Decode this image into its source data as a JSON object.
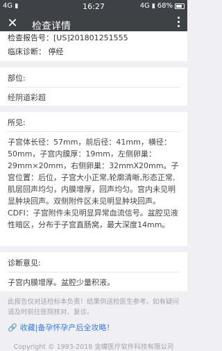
{
  "status_bar": {
    "network": "4G",
    "signal_icon": "signal-icon",
    "time": "16:27",
    "right_network": "4G",
    "battery": "68%"
  },
  "header": {
    "close_icon": "close-icon",
    "title": "检查详情",
    "more_icon": "more-vertical-icon"
  },
  "info": {
    "report_no": "检查报告号：[US]201801251555",
    "clinical_diagnosis": "临床诊断：   停经"
  },
  "position": {
    "title": "部位:",
    "text": "经阴道彩超"
  },
  "findings": {
    "title": "所见:",
    "text": "子宫体长径：57mm，前后径：41mm，横径：50mm，子宫内膜厚：19mm，左侧卵巢：29mm×20mm，右侧卵巢：32mmX20mm。子宫位置：后位，子宫大小正常,轮廓清晰,形态正常,肌层回声均匀，内膜增厚，回声均匀。宫内未见明显肿块回声。双侧附件区未见明显肿块回声。CDFI：子宫附件未见明显异常血流信号。盆腔见液性暗区，分布于子宫直肠窝，最大深度14mm。"
  },
  "diagnosis": {
    "title": "诊断意见:",
    "text": "子宫内膜增厚。盆腔少量积液。"
  },
  "disclaimer": "此报告仅对送检标本负责！结果供送检医生参考。如有疑问请及时前往医院核对、复诊。",
  "promo": {
    "icon": "link-icon",
    "text": "收藏|备孕怀孕产后全攻略！"
  },
  "copyright": "Copyright © 1993-2018 金蝶医疗软件科技有限公司"
}
